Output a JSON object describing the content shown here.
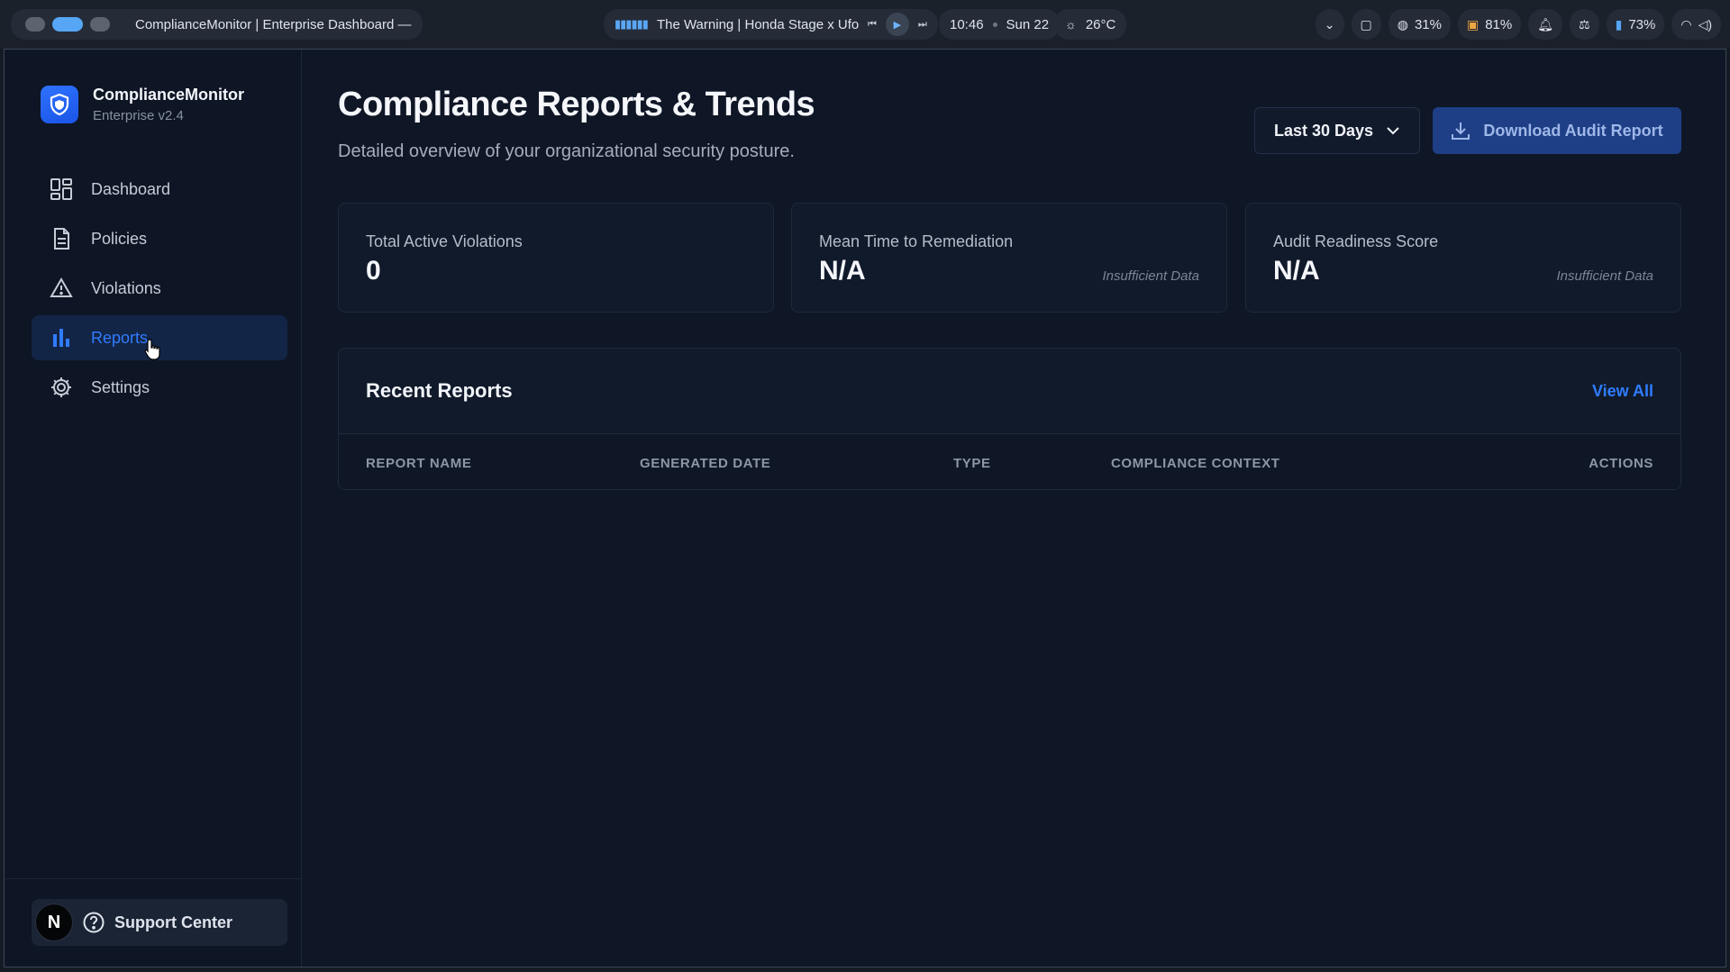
{
  "topbar": {
    "window_title": "ComplianceMonitor | Enterprise Dashboard —",
    "media_title": "The Warning | Honda Stage x Ufor",
    "time": "10:46",
    "date": "Sun 22",
    "weather": "26°C",
    "cpu": "31%",
    "memory": "81%",
    "battery": "73%"
  },
  "sidebar": {
    "brand_name": "ComplianceMonitor",
    "brand_version": "Enterprise v2.4",
    "items": [
      {
        "label": "Dashboard",
        "icon": "grid-icon"
      },
      {
        "label": "Policies",
        "icon": "document-icon"
      },
      {
        "label": "Violations",
        "icon": "warning-icon"
      },
      {
        "label": "Reports",
        "icon": "bar-chart-icon",
        "active": true
      },
      {
        "label": "Settings",
        "icon": "gear-icon"
      }
    ],
    "support_label": "Support Center",
    "avatar_initial": "N"
  },
  "header": {
    "title": "Compliance Reports & Trends",
    "subtitle": "Detailed overview of your organizational security posture.",
    "range_label": "Last 30 Days",
    "download_label": "Download Audit Report"
  },
  "stats": [
    {
      "label": "Total Active Violations",
      "value": "0",
      "note": ""
    },
    {
      "label": "Mean Time to Remediation",
      "value": "N/A",
      "note": "Insufficient Data"
    },
    {
      "label": "Audit Readiness Score",
      "value": "N/A",
      "note": "Insufficient Data"
    }
  ],
  "reports": {
    "title": "Recent Reports",
    "view_all": "View All",
    "columns": [
      "REPORT NAME",
      "GENERATED DATE",
      "TYPE",
      "COMPLIANCE CONTEXT",
      "ACTIONS"
    ],
    "rows": []
  },
  "colors": {
    "accent": "#2f7cff",
    "background": "#0f1626",
    "card": "#111a2b",
    "primary_button": "#1e3f86"
  }
}
